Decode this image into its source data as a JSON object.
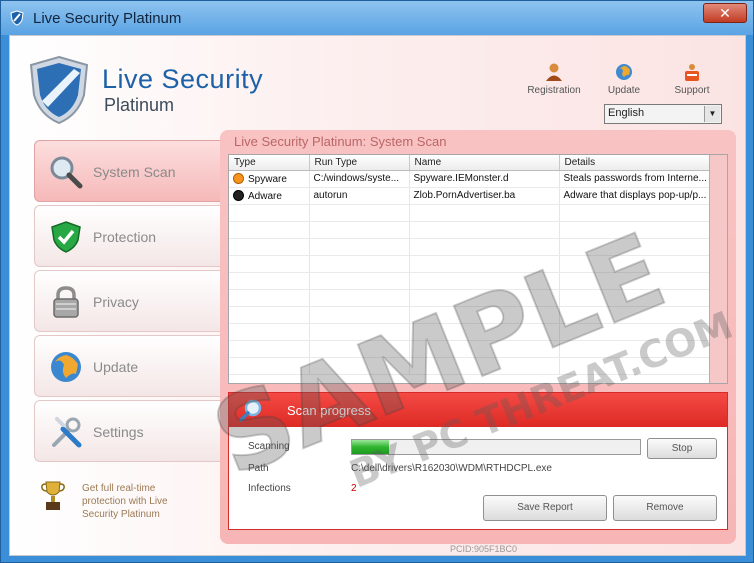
{
  "window": {
    "title": "Live Security Platinum",
    "close_glyph": "✕"
  },
  "logo": {
    "line1": "Live Security",
    "line2": "Platinum",
    "icon": "shield-logo-icon"
  },
  "tools": [
    {
      "label": "Registration",
      "icon": "user-icon"
    },
    {
      "label": "Update",
      "icon": "globe-icon"
    },
    {
      "label": "Support",
      "icon": "lifebuoy-icon"
    }
  ],
  "language": {
    "selected": "English",
    "arrow": "▼"
  },
  "sidebar": {
    "items": [
      {
        "label": "System Scan",
        "icon": "magnifier-icon",
        "active": true
      },
      {
        "label": "Protection",
        "icon": "shield-check-icon"
      },
      {
        "label": "Privacy",
        "icon": "padlock-icon"
      },
      {
        "label": "Update",
        "icon": "globe-icon"
      },
      {
        "label": "Settings",
        "icon": "tools-icon"
      }
    ],
    "promo": {
      "text": "Get full real-time protection with Live Security Platinum",
      "icon": "trophy-icon"
    }
  },
  "scan": {
    "title": "Live Security Platinum: System Scan",
    "columns": [
      "Type",
      "Run Type",
      "Name",
      "Details"
    ],
    "rows": [
      {
        "type": "Spyware",
        "run_type": "C:/windows/syste...",
        "name": "Spyware.IEMonster.d",
        "details": "Steals passwords from Interne...",
        "dot_color": "#f7941d"
      },
      {
        "type": "Adware",
        "run_type": "autorun",
        "name": "Zlob.PornAdvertiser.ba",
        "details": "Adware that displays pop-up/p...",
        "dot_color": "#222222"
      }
    ]
  },
  "progress": {
    "header": "Scan progress",
    "scanning_label": "Scanning",
    "percent": 13,
    "stop_label": "Stop",
    "path_label": "Path",
    "path_value": "C:\\dell\\drivers\\R162030\\WDM\\RTHDCPL.exe",
    "infections_label": "Infections",
    "infections_value": "2",
    "save_report_label": "Save Report",
    "remove_label": "Remove"
  },
  "footer": {
    "pcid": "PCID:905F1BC0"
  },
  "watermark": {
    "line1": "SAMPLE",
    "line2": "BY PC THREAT.COM"
  },
  "colors": {
    "accent_red": "#de2a25",
    "brand_blue": "#1d62a8",
    "infection_red": "#cc0000"
  }
}
